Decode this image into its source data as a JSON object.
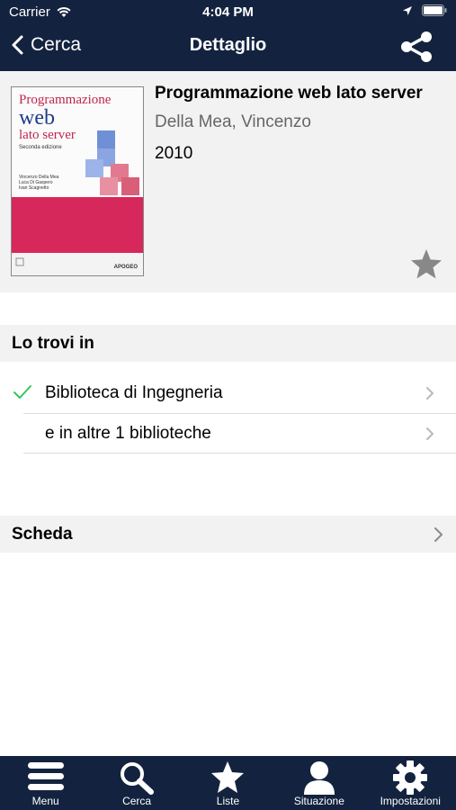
{
  "status_bar": {
    "carrier": "Carrier",
    "time": "4:04 PM"
  },
  "nav": {
    "back_label": "Cerca",
    "title": "Dettaglio"
  },
  "book": {
    "title": "Programmazione web lato server",
    "author": "Della Mea, Vincenzo",
    "year": "2010",
    "cover": {
      "line1": "Programmazione",
      "line2": "web",
      "line3": "lato server",
      "edition": "Seconda edizione",
      "authors": [
        "Vincenzo Della Mea",
        "Luca Di Gaspero",
        "Ivan Scagnetto"
      ],
      "publisher": "APOGEO"
    }
  },
  "availability": {
    "header": "Lo trovi in",
    "items": [
      {
        "label": "Biblioteca di Ingegneria",
        "checked": true
      },
      {
        "label": "e in altre 1 biblioteche",
        "checked": false
      }
    ]
  },
  "scheda": {
    "label": "Scheda"
  },
  "tabbar": {
    "tabs": [
      {
        "label": "Menu",
        "icon": "menu-icon"
      },
      {
        "label": "Cerca",
        "icon": "search-icon"
      },
      {
        "label": "Liste",
        "icon": "star-icon"
      },
      {
        "label": "Situazione",
        "icon": "person-icon"
      },
      {
        "label": "Impostazioni",
        "icon": "gear-icon"
      }
    ]
  },
  "colors": {
    "nav_bg": "#13233f",
    "panel_bg": "#f2f2f3",
    "check_green": "#34c759",
    "cover_red": "#d6285a"
  }
}
